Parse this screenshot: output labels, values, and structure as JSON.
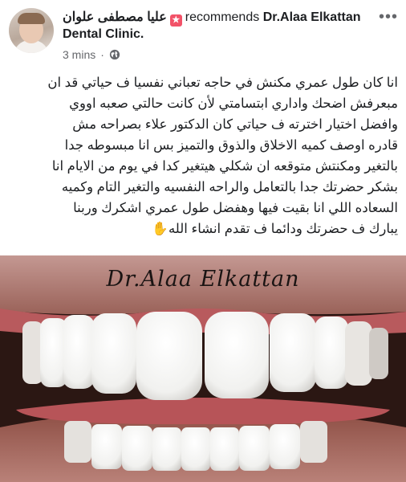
{
  "post": {
    "author": "عليا مصطفى علوان",
    "verb": "recommends",
    "page_name": "Dr.Alaa Elkattan Dental Clinic.",
    "time": "3 mins",
    "separator": "·",
    "more_icon": "more-horizontal-icon",
    "privacy_icon": "globe-icon",
    "badge_icon": "star-badge-icon",
    "accent_color": "#f25268",
    "text_lines": [
      "انا كان طول عمري مكنش في حاجه تعباني نفسيا ف حياتي قد ان",
      "مبعرفش اضحك واداري ابتسامتي  لأن كانت حالتي صعبه اووي",
      "وافضل اختيار اخترته ف حياتي كان الدكتور علاء بصراحه مش",
      "قادره اوصف كميه الاخلاق والذوق والتميز  بس انا مبسوطه جدا",
      "بالتغير ومكنتش متوقعه ان شكلي هيتغير كدا في يوم من الايام انا",
      "بشكر حضرتك جدا بالتعامل والراحه النفسيه والتغير التام وكميه",
      "السعاده اللي انا بقيت فيها وهفضل طول عمري اشكرك وربنا",
      "يبارك ف حضرتك ودائما ف تقدم انشاء الله"
    ],
    "wave_emoji": "✋"
  },
  "photo": {
    "watermark": "Dr.Alaa Elkattan"
  }
}
